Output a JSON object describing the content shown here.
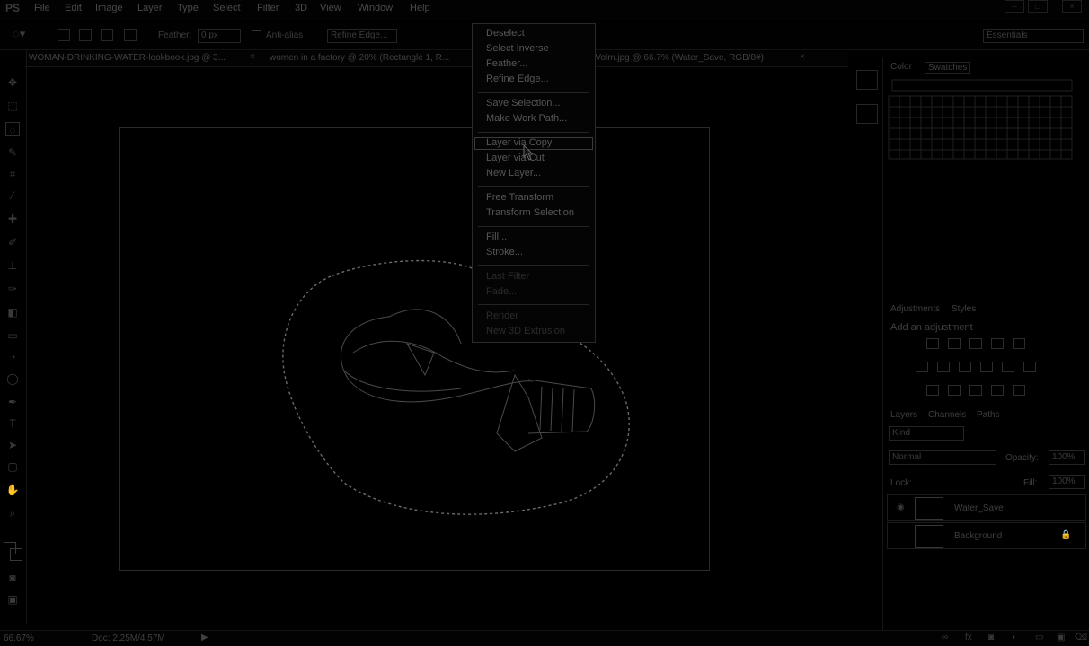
{
  "app": {
    "logo": "PS"
  },
  "menu": [
    "File",
    "Edit",
    "Image",
    "Layer",
    "Type",
    "Select",
    "Filter",
    "3D",
    "View",
    "Window",
    "Help"
  ],
  "options": {
    "feather_label": "Feather:",
    "feather_value": "0 px",
    "antialias_label": "Anti-alias",
    "refine_button": "Refine Edge...",
    "workspace": "Essentials"
  },
  "tabs": [
    "WOMAN-DRINKING-WATER-lookbook.jpg @ 3...",
    "women in a factory @ 20% (Rectangle 1, R...",
    "...Volm.jpg @ 66.7% (Water_Save, RGB/8#)"
  ],
  "context_menu": {
    "items": [
      {
        "label": "Deselect",
        "enabled": true
      },
      {
        "label": "Select Inverse",
        "enabled": true
      },
      {
        "label": "Feather...",
        "enabled": true
      },
      {
        "label": "Refine Edge...",
        "enabled": true
      },
      {
        "label": "Save Selection...",
        "enabled": true
      },
      {
        "label": "Make Work Path...",
        "enabled": true
      },
      {
        "label": "Layer via Copy",
        "enabled": true,
        "highlighted": true
      },
      {
        "label": "Layer via Cut",
        "enabled": true
      },
      {
        "label": "New Layer...",
        "enabled": true
      },
      {
        "label": "Free Transform",
        "enabled": true
      },
      {
        "label": "Transform Selection",
        "enabled": true
      },
      {
        "label": "Fill...",
        "enabled": true
      },
      {
        "label": "Stroke...",
        "enabled": true
      },
      {
        "label": "Last Filter",
        "enabled": false
      },
      {
        "label": "Fade...",
        "enabled": false
      },
      {
        "label": "Render",
        "enabled": false
      },
      {
        "label": "New 3D Extrusion",
        "enabled": false
      }
    ]
  },
  "panels": {
    "color_tabs": [
      "Color",
      "Swatches"
    ],
    "adjust_tabs": [
      "Adjustments",
      "Styles"
    ],
    "adjust_hint": "Add an adjustment",
    "layer_tabs": [
      "Layers",
      "Channels",
      "Paths"
    ],
    "kind_filter": "Kind",
    "blend_mode": "Normal",
    "opacity_label": "Opacity:",
    "opacity_value": "100%",
    "lock_label": "Lock:",
    "fill_label": "Fill:",
    "fill_value": "100%",
    "layers": [
      {
        "name": "Water_Save",
        "visible": true,
        "locked": false
      },
      {
        "name": "Background",
        "visible": false,
        "locked": true
      }
    ]
  },
  "status": {
    "zoom": "66.67%",
    "doc": "Doc: 2.25M/4.57M"
  },
  "icons": {
    "logo": "ps-logo",
    "tools": [
      "move-icon",
      "marquee-icon",
      "lasso-icon",
      "quick-select-icon",
      "crop-icon",
      "eyedropper-icon",
      "healing-icon",
      "brush-icon",
      "clone-icon",
      "history-brush-icon",
      "eraser-icon",
      "gradient-icon",
      "blur-icon",
      "dodge-icon",
      "pen-icon",
      "type-icon",
      "path-select-icon",
      "shape-icon",
      "hand-icon",
      "zoom-icon"
    ]
  }
}
